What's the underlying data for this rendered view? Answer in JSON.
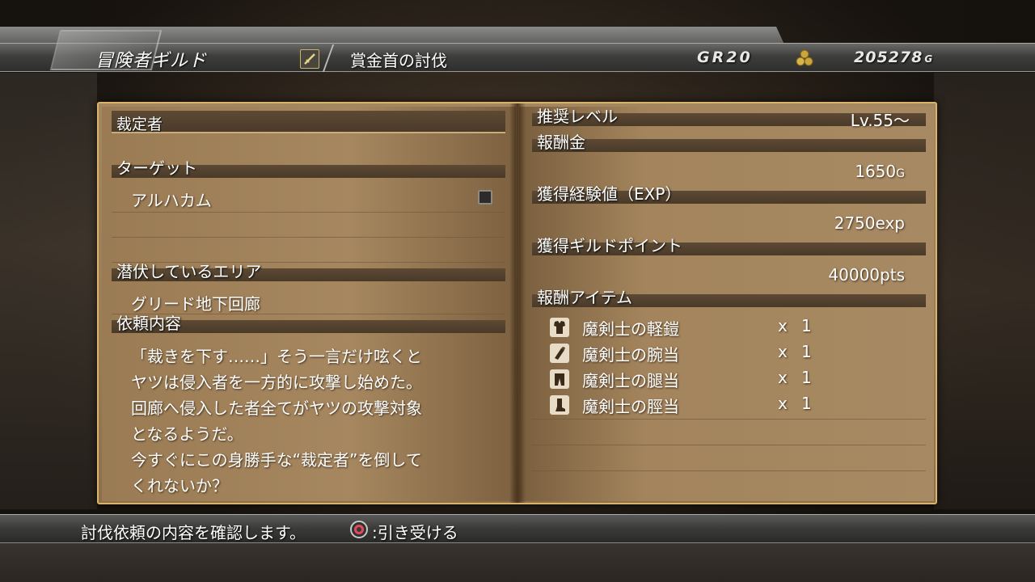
{
  "header": {
    "title": "冒険者ギルド",
    "subtitle": "賞金首の討伐",
    "rank": "GR20",
    "money": "205278",
    "money_unit": "G"
  },
  "left_page": {
    "quest_name": "裁定者",
    "target_label": "ターゲット",
    "target_name": "アルハカム",
    "area_label": "潜伏しているエリア",
    "area_name": "グリード地下回廊",
    "request_label": "依頼内容",
    "description": [
      "「裁きを下す……」そう一言だけ呟くと",
      "ヤツは侵入者を一方的に攻撃し始めた。",
      "回廊へ侵入した者全てがヤツの攻撃対象",
      "となるようだ。",
      "今すぐにこの身勝手な“裁定者”を倒して",
      "くれないか？"
    ]
  },
  "right_page": {
    "level_label": "推奨レベル",
    "level_value": "Lv.55～",
    "reward_money_label": "報酬金",
    "reward_money_value": "1650",
    "reward_money_unit": "G",
    "exp_label": "獲得経験値（EXP）",
    "exp_value": "2750",
    "exp_unit": "exp",
    "gp_label": "獲得ギルドポイント",
    "gp_value": "40000",
    "gp_unit": "pts",
    "items_label": "報酬アイテム",
    "items": [
      {
        "name": "魔剣士の軽鎧",
        "x": "x",
        "qty": "1",
        "icon": "armor-icon"
      },
      {
        "name": "魔剣士の腕当",
        "x": "x",
        "qty": "1",
        "icon": "gauntlet-icon"
      },
      {
        "name": "魔剣士の腿当",
        "x": "x",
        "qty": "1",
        "icon": "legguard-icon"
      },
      {
        "name": "魔剣士の脛当",
        "x": "x",
        "qty": "1",
        "icon": "boot-icon"
      }
    ]
  },
  "footer": {
    "message": "討伐依頼の内容を確認します。",
    "action": ":引き受ける",
    "button_icon": "circle-button-icon"
  },
  "colors": {
    "page": "#a4865f",
    "header_band": "#4a3a28",
    "border_gold": "#d9b36a",
    "circle_button": "#e04a5a"
  }
}
